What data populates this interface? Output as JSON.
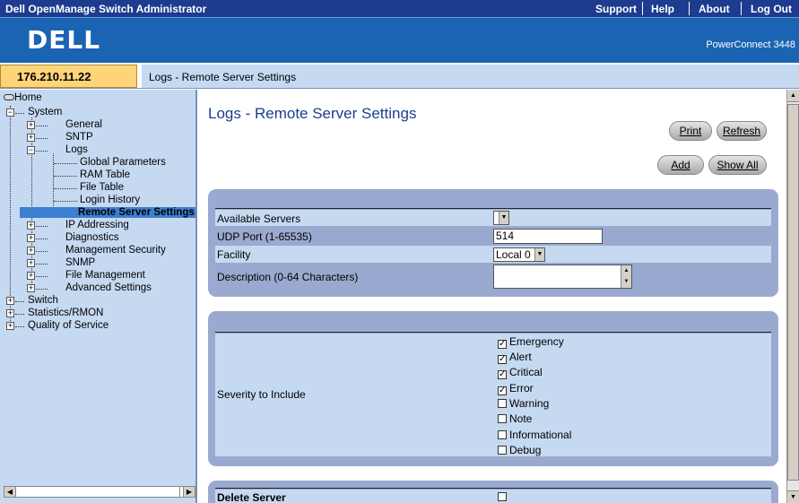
{
  "app_title": "Dell OpenManage Switch Administrator",
  "top_links": [
    "Support",
    "Help",
    "About",
    "Log Out"
  ],
  "brand": {
    "logo": "DELL",
    "model": "PowerConnect 3448"
  },
  "ip_address": "176.210.11.22",
  "breadcrumb": "Logs - Remote Server Settings",
  "tree": {
    "home": "Home",
    "system": "System",
    "general": "General",
    "sntp": "SNTP",
    "logs": "Logs",
    "global_parameters": "Global Parameters",
    "ram_table": "RAM Table",
    "file_table": "File Table",
    "login_history": "Login History",
    "remote_server_settings": "Remote Server Settings",
    "ip_addressing": "IP Addressing",
    "diagnostics": "Diagnostics",
    "management_security": "Management Security",
    "snmp": "SNMP",
    "file_management": "File Management",
    "advanced_settings": "Advanced Settings",
    "switch": "Switch",
    "statistics_rmon": "Statistics/RMON",
    "quality_of_service": "Quality of Service"
  },
  "page_title": "Logs - Remote Server Settings",
  "buttons": {
    "print": "Print",
    "refresh": "Refresh",
    "add": "Add",
    "show_all": "Show All"
  },
  "form": {
    "available_servers_label": "Available Servers",
    "available_servers_value": "",
    "udp_port_label": "UDP Port (1-65535)",
    "udp_port_value": "514",
    "facility_label": "Facility",
    "facility_value": "Local 0",
    "description_label": "Description (0-64 Characters)",
    "description_value": ""
  },
  "severity": {
    "label": "Severity to Include",
    "levels": [
      {
        "name": "Emergency",
        "checked": true
      },
      {
        "name": "Alert",
        "checked": true
      },
      {
        "name": "Critical",
        "checked": true
      },
      {
        "name": "Error",
        "checked": true
      },
      {
        "name": "Warning",
        "checked": false
      },
      {
        "name": "Note",
        "checked": false
      },
      {
        "name": "Informational",
        "checked": false
      },
      {
        "name": "Debug",
        "checked": false
      }
    ]
  },
  "delete_server_label": "Delete Server",
  "colors": {
    "topbar": "#1d3c8f",
    "banner": "#1b63b3",
    "panel": "#9aa9cf",
    "row": "#c5d9f1",
    "selected": "#3d7fd0",
    "ipbox": "#ffd479"
  }
}
